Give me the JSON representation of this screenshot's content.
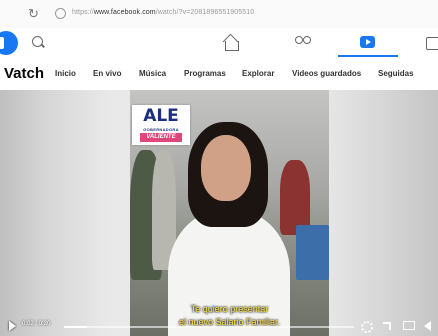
{
  "browser": {
    "url_prefix": "https://",
    "url_domain": "www.facebook.com",
    "url_path": "/watch/?v=2081896551905510"
  },
  "nav": {
    "active": "watch",
    "accent_color": "#1877f2",
    "icons": [
      "facebook-logo",
      "search-icon",
      "home-icon",
      "friends-icon",
      "watch-icon",
      "marketplace-icon"
    ]
  },
  "watch": {
    "title": "Vatch",
    "tabs": [
      "Inicio",
      "En vivo",
      "Música",
      "Programas",
      "Explorar",
      "Videos guardados",
      "Seguidas"
    ]
  },
  "video": {
    "logo": {
      "name": "ALE",
      "line": "GOBERNADORA",
      "tag": "VALIENTE"
    },
    "subtitle_line1": "Te quiero presentar",
    "subtitle_line2": "el nuevo Salario Familiar.",
    "time": "0:02 / 0:30",
    "progress": 0.08
  }
}
